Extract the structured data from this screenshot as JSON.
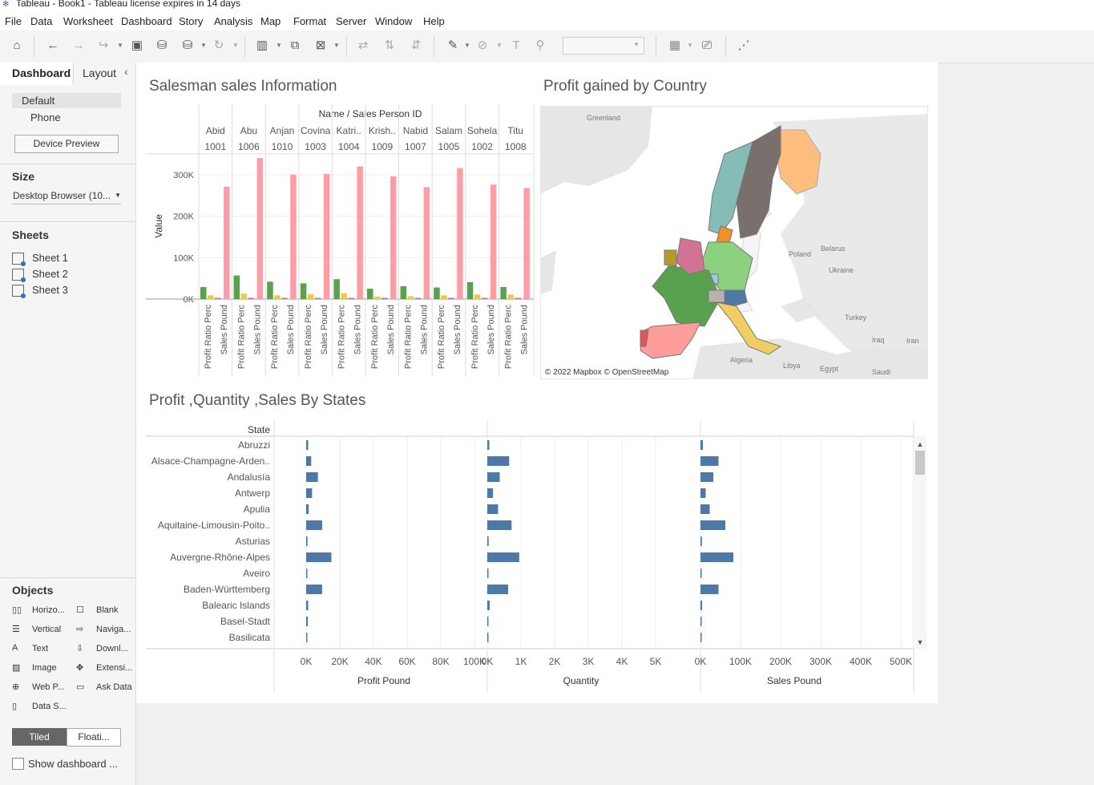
{
  "window": {
    "title": "Tableau - Book1 - Tableau license expires in 14 days"
  },
  "menu": [
    "File",
    "Data",
    "Worksheet",
    "Dashboard",
    "Story",
    "Analysis",
    "Map",
    "Format",
    "Server",
    "Window",
    "Help"
  ],
  "sidebar": {
    "tab_dashboard": "Dashboard",
    "tab_layout": "Layout",
    "device_default": "Default",
    "device_phone": "Phone",
    "device_preview": "Device Preview",
    "size_header": "Size",
    "size_value": "Desktop Browser (10...",
    "sheets_header": "Sheets",
    "sheets": [
      "Sheet 1",
      "Sheet 2",
      "Sheet 3"
    ],
    "objects_header": "Objects",
    "objects_left": [
      "Horizo...",
      "Vertical",
      "Text",
      "Image",
      "Web P...",
      "Data S..."
    ],
    "objects_right": [
      "Blank",
      "Naviga...",
      "Downl...",
      "Extensi...",
      "Ask Data"
    ],
    "tiled": "Tiled",
    "floating": "Floati...",
    "show_title": "Show dashboard ..."
  },
  "sheet1": {
    "title": "Salesman sales Information",
    "header": "Name / Sales Person ID",
    "ylabel": "Value",
    "measure_labels": [
      "Profit Ratio Perc",
      "Sales Pound"
    ]
  },
  "sheet2": {
    "title": "Profit gained by Country",
    "attribution": "© 2022 Mapbox © OpenStreetMap",
    "labels": [
      "Greenland",
      "Poland",
      "Belarus",
      "Ukraine",
      "Turkey",
      "Iraq",
      "Iran",
      "Algeria",
      "Libya",
      "Egypt",
      "Saudi"
    ]
  },
  "sheet3": {
    "title": "Profit ,Quantity ,Sales By States",
    "row_header": "State"
  },
  "chart_data": [
    {
      "type": "bar",
      "title": "Salesman sales Information",
      "ylabel": "Value",
      "ylim": [
        0,
        350000
      ],
      "yticks": [
        "0K",
        "100K",
        "200K",
        "300K"
      ],
      "categories": [
        "Abid",
        "Abu",
        "Anjan",
        "Covina",
        "Katri..",
        "Krish..",
        "Nabid",
        "Salam",
        "Sohela",
        "Titu"
      ],
      "ids": [
        "1001",
        "1006",
        "1010",
        "1003",
        "1004",
        "1009",
        "1007",
        "1005",
        "1002",
        "1008"
      ],
      "series": [
        {
          "name": "Profit Pound",
          "color": "#59a14f",
          "values": [
            29000,
            57000,
            42000,
            38000,
            48000,
            25000,
            31000,
            28000,
            41000,
            29000
          ]
        },
        {
          "name": "Quantity",
          "color": "#edc948",
          "values": [
            9000,
            13000,
            9000,
            12000,
            14000,
            6000,
            7000,
            9000,
            11000,
            11000
          ]
        },
        {
          "name": "Profit Ratio Perc",
          "color": "#b07aa1",
          "values": [
            3000,
            3000,
            3000,
            3000,
            3000,
            3000,
            3000,
            3000,
            3000,
            3000
          ]
        },
        {
          "name": "Sales Pound",
          "color": "#ff9da7",
          "values": [
            271000,
            340000,
            300000,
            302000,
            320000,
            296000,
            270000,
            316000,
            276000,
            268000
          ]
        }
      ]
    },
    {
      "type": "bar",
      "title": "Profit ,Quantity ,Sales By States",
      "categories": [
        "Abruzzi",
        "Alsace-Champagne-Arden..",
        "Andalusía",
        "Antwerp",
        "Apulia",
        "Aquitaine-Limousin-Poito..",
        "Asturias",
        "Auvergne-Rhône-Alpes",
        "Aveiro",
        "Baden-Württemberg",
        "Balearic Islands",
        "Basel-Stadt",
        "Basilicata"
      ],
      "color": "#4e79a7",
      "panels": [
        {
          "name": "Profit Pound",
          "xlim": [
            0,
            100000
          ],
          "ticks": [
            "0K",
            "20K",
            "40K",
            "60K",
            "80K",
            "100K"
          ],
          "values": [
            1200,
            3000,
            7000,
            3500,
            1500,
            9500,
            800,
            15000,
            300,
            9500,
            1200,
            1000,
            400
          ]
        },
        {
          "name": "Quantity",
          "xlim": [
            0,
            5500
          ],
          "ticks": [
            "0K",
            "1K",
            "2K",
            "3K",
            "4K",
            "5K"
          ],
          "values": [
            60,
            650,
            370,
            170,
            320,
            720,
            40,
            950,
            20,
            620,
            70,
            30,
            20
          ]
        },
        {
          "name": "Sales Pound",
          "xlim": [
            0,
            500000
          ],
          "ticks": [
            "0K",
            "100K",
            "200K",
            "300K",
            "400K",
            "500K"
          ],
          "values": [
            6000,
            45000,
            32000,
            13000,
            23000,
            62000,
            3500,
            82000,
            1500,
            45000,
            4000,
            3000,
            1500
          ]
        }
      ]
    }
  ]
}
